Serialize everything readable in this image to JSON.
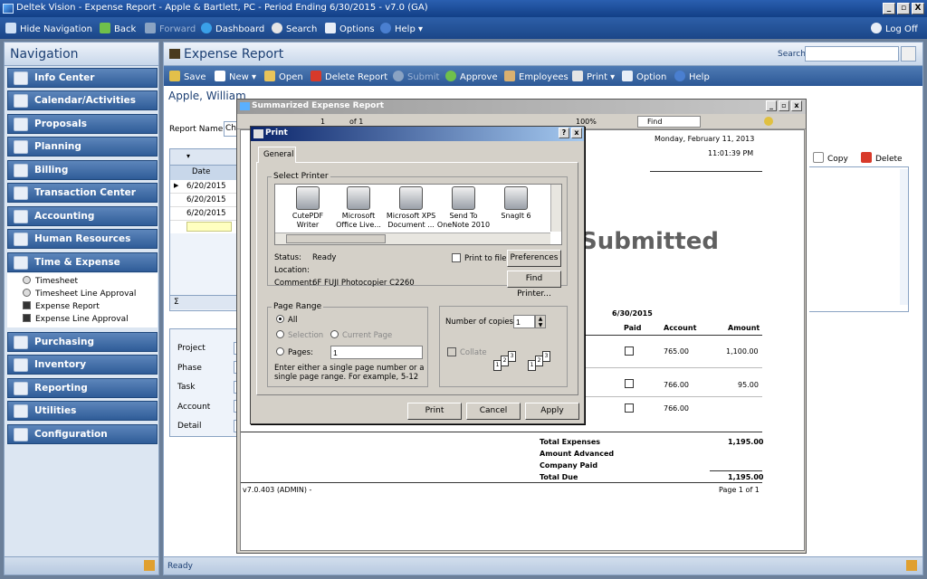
{
  "window": {
    "title": "Deltek Vision - Expense Report - Apple & Bartlett, PC - Period Ending 6/30/2015 - v7.0 (GA)",
    "buttons": [
      "_",
      "▫",
      "X"
    ]
  },
  "menubar": {
    "hide_navigation": "Hide Navigation",
    "back": "Back",
    "forward": "Forward",
    "dashboard": "Dashboard",
    "search": "Search",
    "options": "Options",
    "help": "Help ▾",
    "logoff": "Log Off"
  },
  "nav": {
    "title": "Navigation",
    "items": [
      {
        "label": "Info Center"
      },
      {
        "label": "Calendar/Activities"
      },
      {
        "label": "Proposals"
      },
      {
        "label": "Planning"
      },
      {
        "label": "Billing"
      },
      {
        "label": "Transaction Center"
      },
      {
        "label": "Accounting"
      },
      {
        "label": "Human Resources"
      },
      {
        "label": "Time & Expense"
      },
      {
        "label": "Purchasing"
      },
      {
        "label": "Inventory"
      },
      {
        "label": "Reporting"
      },
      {
        "label": "Utilities"
      },
      {
        "label": "Configuration"
      }
    ],
    "time_expense_sub": [
      "Timesheet",
      "Timesheet Line Approval",
      "Expense Report",
      "Expense Line Approval"
    ]
  },
  "main": {
    "title": "Expense Report",
    "search_label": "Search",
    "search_value": "",
    "toolbar": {
      "save": "Save",
      "new": "New ▾",
      "open": "Open",
      "delete_report": "Delete Report",
      "submit": "Submit",
      "approve": "Approve",
      "employees": "Employees",
      "print": "Print ▾",
      "option": "Option",
      "help": "Help"
    },
    "employee": "Apple, William",
    "report_name_label": "Report Name",
    "report_name_value": "Ch",
    "grid_header_date": "Date",
    "grid_dates": [
      "6/20/2015",
      "6/20/2015",
      "6/20/2015"
    ],
    "sigma": "Σ",
    "grid_actions": {
      "copy": "Copy",
      "delete": "Delete"
    },
    "detail_labels": [
      "Project",
      "Phase",
      "Task",
      "Account",
      "Detail"
    ],
    "partial_letters": {
      "s1": "S",
      "ap": "Ap",
      "er": "Er",
      "s2": "S",
      "a": "A",
      "o": "O",
      "e": "E",
      "da": "Da",
      "six1": "6/",
      "six2": "6/",
      "six3": "6/"
    },
    "status": "Ready"
  },
  "report_window": {
    "title": "Summarized Expense Report",
    "toolbar_page": "1",
    "toolbar_of": "of 1",
    "zoom": "100%",
    "find": "Find",
    "date": "Monday, February 11, 2013",
    "time": "11:01:39 PM",
    "watermark": "Submitted",
    "period": "6/30/2015",
    "columns": {
      "paid": "Paid",
      "account": "Account",
      "amount": "Amount"
    },
    "rows": [
      {
        "account": "765.00",
        "amount": "1,100.00"
      },
      {
        "account": "766.00",
        "amount": "95.00"
      },
      {
        "account": "766.00",
        "amount": ""
      }
    ],
    "totals": [
      {
        "label": "Total Expenses",
        "value": "1,195.00"
      },
      {
        "label": "Amount Advanced",
        "value": ""
      },
      {
        "label": "Company Paid",
        "value": ""
      },
      {
        "label": "Total Due",
        "value": "1,195.00"
      }
    ],
    "footer_left": "v7.0.403 (ADMIN) -",
    "footer_right": "Page 1 of 1"
  },
  "print_dialog": {
    "title": "Print",
    "tab": "General",
    "select_printer": "Select Printer",
    "printers": [
      {
        "line1": "CutePDF",
        "line2": "Writer"
      },
      {
        "line1": "Microsoft",
        "line2": "Office Live..."
      },
      {
        "line1": "Microsoft XPS",
        "line2": "Document ..."
      },
      {
        "line1": "Send To",
        "line2": "OneNote 2010"
      },
      {
        "line1": "SnagIt 6",
        "line2": ""
      }
    ],
    "status_label": "Status:",
    "status_value": "Ready",
    "location_label": "Location:",
    "comment_label": "Comment:",
    "comment_value": "6F FUJI Photocopier C2260",
    "print_to_file": "Print to file",
    "preferences": "Preferences",
    "find_printer": "Find Printer...",
    "page_range": "Page Range",
    "all": "All",
    "selection": "Selection",
    "current_page": "Current Page",
    "pages": "Pages:",
    "pages_value": "1",
    "hint": "Enter either a single page number or a single page range.  For example, 5-12",
    "copies_label": "Number of copies:",
    "copies_value": "1",
    "collate": "Collate",
    "btn_print": "Print",
    "btn_cancel": "Cancel",
    "btn_apply": "Apply"
  }
}
